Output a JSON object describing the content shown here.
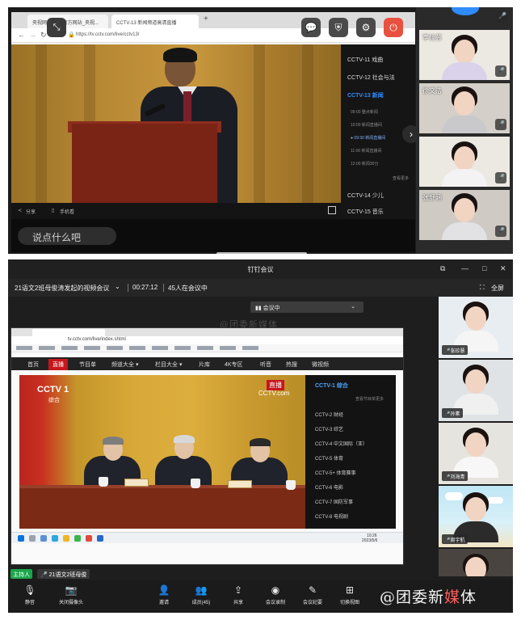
{
  "top": {
    "browser": {
      "tabs": [
        "央视网_CCTV官方网站_央视...",
        "CCTV-13 新闻频道高清直播"
      ],
      "url": "https://tv.cctv.com/live/cctv13/"
    },
    "player": {
      "share_label": "分享",
      "phone_label": "手机看"
    },
    "channels": [
      {
        "label": "CCTV-11 戏曲",
        "active": false
      },
      {
        "label": "CCTV-12 社会与法",
        "active": false
      },
      {
        "label": "CCTV-13 新闻",
        "active": true
      },
      {
        "label": "CCTV-14 少儿",
        "active": false
      },
      {
        "label": "CCTV-15 音乐",
        "active": false
      }
    ],
    "programs": [
      "09:00 整点新闻",
      "10:00 新闻直播间",
      "● 09:30 新闻直播间",
      "11:00 新闻直播间",
      "12:00 新闻30分"
    ],
    "more_label": "查看更多",
    "chat_placeholder": "说点什么吧",
    "controls": {
      "chat": "💬",
      "shield": "⛨",
      "settings": "⚙",
      "leave": "⏻"
    },
    "participants": [
      {
        "name": "李佳芸"
      },
      {
        "name": "徐文洁"
      },
      {
        "name": ""
      },
      {
        "name": "张舒涵"
      }
    ],
    "colors": {
      "leave_button": "#e8513f",
      "active_channel": "#2f8cff"
    }
  },
  "bottom": {
    "app_title": "钉钉会议",
    "window_controls": {
      "mirror": "⧉",
      "minimize": "—",
      "maximize": "□",
      "close": "✕"
    },
    "meeting_title": "21语文2班母俊涛发起的视频会议",
    "elapsed": "00:27:12",
    "attendance": "45人在会议中",
    "fullscreen_label": "全屏",
    "sharing_banner": "会议中",
    "watermark": "@团委新媒体",
    "shared_screen": {
      "url": "tv.cctv.com/live/index.shtml",
      "nav": [
        "首页",
        "直播",
        "节目单",
        "频道大全 ▾",
        "栏目大全 ▾",
        "片库",
        "4K专区",
        "听音",
        "热搜",
        "微视频"
      ],
      "nav_active": "直播",
      "channel_title": "CCTV-1 综合",
      "channel_more": "查看节目单更多",
      "channels": [
        "CCTV-2 财经",
        "CCTV-3 综艺",
        "CCTV-4 中文国际（亚）",
        "CCTV-5 体育",
        "CCTV-5+ 体育赛事",
        "CCTV-6 电影",
        "CCTV-7 国防军事",
        "CCTV-8 电视剧"
      ],
      "logo": "CCTV 1",
      "logo_sub": "综合",
      "live_badge": "直播",
      "live_logo": "CCTV.com",
      "clock": "10:26",
      "date": "2023/5/6"
    },
    "host_badge": "主持人",
    "host_name": "21语文2班母俊",
    "right_participants": [
      {
        "name": "张珍慧"
      },
      {
        "name": "孙素"
      },
      {
        "name": "刘海青"
      },
      {
        "name": "周宇航"
      }
    ],
    "toolbar": [
      {
        "icon": "🎙",
        "label": "静音",
        "name": "mute"
      },
      {
        "icon": "📷",
        "label": "关闭摄像头",
        "name": "camera"
      },
      {
        "icon": "👤",
        "label": "邀请",
        "name": "invite"
      },
      {
        "icon": "👥",
        "label": "成员(45)",
        "name": "members"
      },
      {
        "icon": "⇪",
        "label": "共享",
        "name": "share"
      },
      {
        "icon": "◉",
        "label": "会议录制",
        "name": "record"
      },
      {
        "icon": "✎",
        "label": "会议纪要",
        "name": "minutes"
      },
      {
        "icon": "⊞",
        "label": "切换视图",
        "name": "layout"
      }
    ],
    "brand_watermark": "@团委新",
    "brand_watermark_accent": "媒",
    "brand_watermark_tail": "体",
    "colors": {
      "host_badge": "#1aa64a",
      "live_nav": "#c8161d"
    }
  }
}
